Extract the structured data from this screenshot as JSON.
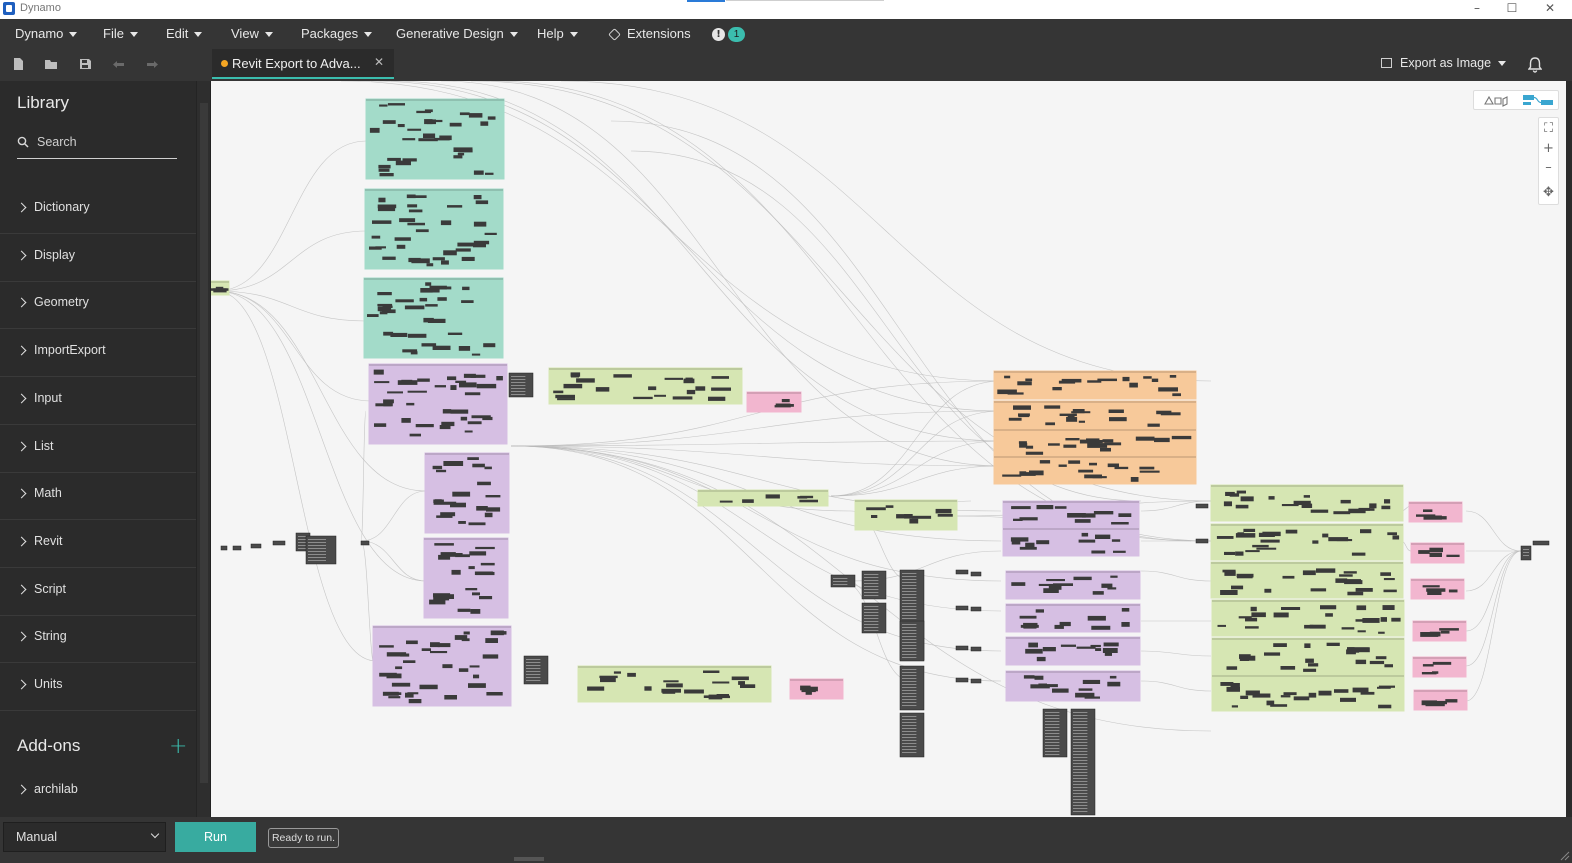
{
  "window": {
    "title": "Dynamo",
    "controls": [
      "minimize-icon",
      "maximize-icon",
      "close-icon"
    ]
  },
  "menu": {
    "items": [
      "Dynamo",
      "File",
      "Edit",
      "View",
      "Packages",
      "Generative Design",
      "Help"
    ],
    "extensions_label": "Extensions",
    "notification_count": "1"
  },
  "toolbar": {
    "icons": [
      "new-file-icon",
      "open-folder-icon",
      "save-icon",
      "undo-icon",
      "redo-icon"
    ],
    "tab_title": "Revit Export to Adva...",
    "tab_modified": true,
    "export_label": "Export as Image"
  },
  "library": {
    "title": "Library",
    "search_placeholder": "Search",
    "categories": [
      "Dictionary",
      "Display",
      "Geometry",
      "ImportExport",
      "Input",
      "List",
      "Math",
      "Revit",
      "Script",
      "String",
      "Units"
    ],
    "addons_title": "Add-ons",
    "addons": [
      "archilab"
    ]
  },
  "canvas": {
    "group_colors": {
      "teal": "#a3dbc9",
      "purple": "#d6bfe3",
      "green": "#d6e6b3",
      "pink": "#f2b6cf",
      "orange": "#f7c99a"
    },
    "zoom_controls": [
      "fit-view-icon",
      "zoom-in-icon",
      "zoom-out-icon",
      "pan-icon"
    ]
  },
  "status": {
    "run_mode": "Manual",
    "run_label": "Run",
    "status_text": "Ready to run."
  },
  "colors": {
    "accent": "#3bbdae",
    "run_button": "#38aba0",
    "modified_dot": "#f5a623"
  }
}
